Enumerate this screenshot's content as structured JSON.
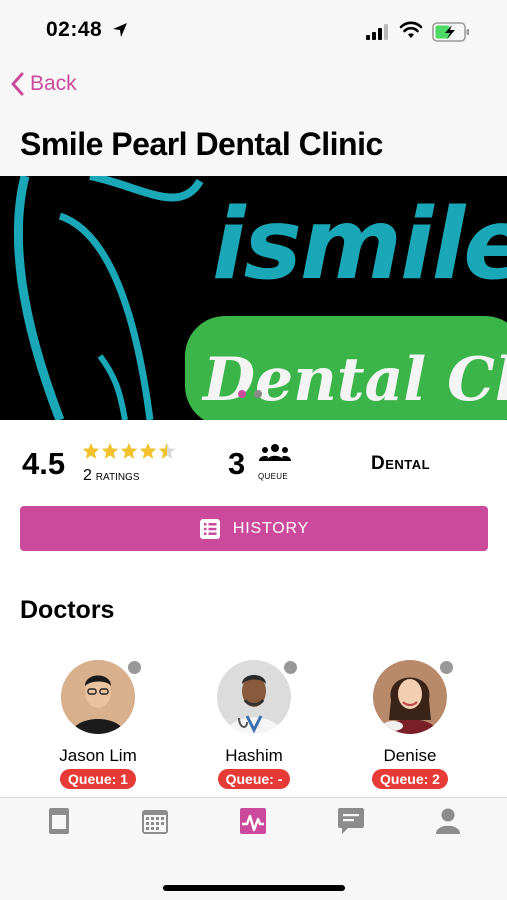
{
  "status_bar": {
    "time": "02:48"
  },
  "nav": {
    "back_label": "Back"
  },
  "page": {
    "title": "Smile Pearl Dental Clinic"
  },
  "banner": {
    "logo_text_top": "ismile",
    "logo_text_bottom": "Dental Clinic",
    "slides": 2,
    "active_slide": 1
  },
  "stats": {
    "rating": "4.5",
    "rating_stars": 4.5,
    "ratings_count": "2",
    "ratings_label": "ratings",
    "queue_count": "3",
    "queue_label": "queue",
    "category": "Dental"
  },
  "history_button": {
    "label": "HISTORY",
    "icon": "list-icon"
  },
  "doctors_section": {
    "title": "Doctors",
    "doctors": [
      {
        "name": "Jason Lim",
        "queue": "Queue: 1"
      },
      {
        "name": "Hashim",
        "queue": "Queue: -"
      },
      {
        "name": "Denise",
        "queue": "Queue: 2"
      }
    ]
  },
  "tab_bar": {
    "tabs": [
      "clinic-icon",
      "calendar-icon",
      "activity-icon",
      "chat-icon",
      "profile-icon"
    ],
    "active": "activity-icon"
  },
  "colors": {
    "accent": "#cc4a9b",
    "badge": "#e53a35",
    "star": "#f2c12e",
    "banner_teal": "#1aa7b8",
    "banner_green": "#3bb54a"
  }
}
